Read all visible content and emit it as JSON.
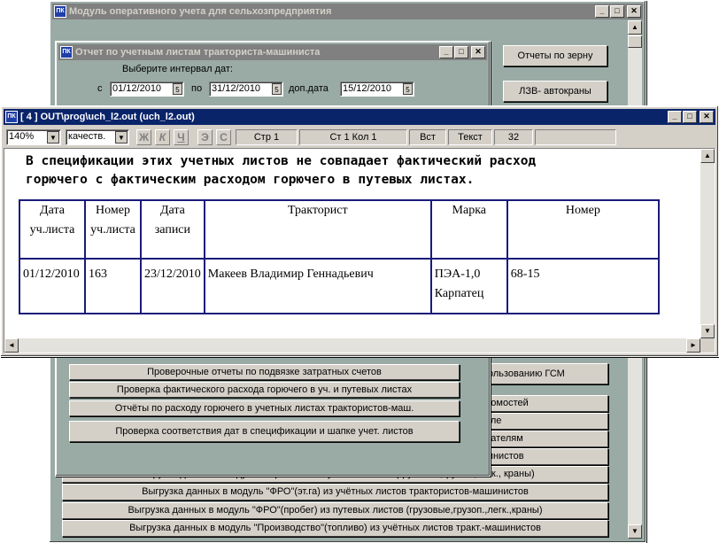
{
  "main_window": {
    "title": "Модуль оперативного учета для сельхозпредприятия",
    "right_buttons": [
      "Отчеты по зерну",
      "ЛЗВ- автокраны",
      "пользованию ГСМ",
      "едомостей",
      "поле",
      "одателям",
      "шинистов"
    ],
    "export_buttons": [
      "Выгрузка данных в модуль \"Зарплата\"из путевых листов (грузовые,грузоп.,легк., краны)",
      "Выгрузка данных в модуль \"ФРО\"(эт.га) из учётных листов трактористов-машинистов",
      "Выгрузка данных в модуль \"ФРО\"(пробег) из путевых листов (грузовые,грузоп.,легк.,краны)",
      "Выгрузка данных в модуль \"Производство\"(топливо) из учётных листов тракт.-машинистов"
    ]
  },
  "report_dialog": {
    "title": "Отчет по учетным листам тракториста-машиниста",
    "interval_label": "Выберите интервал дат:",
    "from_label": "с",
    "to_label": "по",
    "extra_label": "доп.дата",
    "date_from": "01/12/2010",
    "date_to": "31/12/2010",
    "date_extra": "15/12/2010",
    "buttons": [
      "Проверочные отчеты по подвязке затратных счетов",
      "Проверка фактического расхода горючего в уч. и путевых листах",
      "Отчёты по расходу горючего в учетных листах трактористов-маш.",
      "Проверка соответствия дат в спецификации и шапке учет. листов"
    ]
  },
  "viewer": {
    "title": "[ 4 ]  OUT\\prog\\uch_l2.out (uch_l2.out)",
    "zoom": "140%",
    "quality": "качеств.",
    "format_buttons": [
      "Ж",
      "К",
      "Ч",
      "Э",
      "С"
    ],
    "status": {
      "page": "Стр 1",
      "line_col": "Ст 1  Кол 1",
      "mode": "Вст",
      "type": "Текст",
      "num": "32"
    },
    "message_line1": "В спецификации этих учетных листов не совпадает фактический расход",
    "message_line2": "горючего с фактическим расходом горючего в путевых листах.",
    "table": {
      "headers": [
        [
          "Дата",
          "уч.листа"
        ],
        [
          "Номер",
          "уч.листа"
        ],
        [
          "Дата",
          "записи"
        ],
        [
          "Тракторист",
          ""
        ],
        [
          "Марка",
          ""
        ],
        [
          "Номер",
          ""
        ]
      ],
      "rows": [
        [
          "01/12/2010",
          "163",
          "23/12/2010",
          "Макеев Владимир Геннадьевич",
          "ПЭА-1,0 Карпатец",
          "68-15"
        ]
      ]
    }
  },
  "icons": {
    "app": "app-icon",
    "scroll_up": "arrow-up-icon",
    "scroll_down": "arrow-down-icon",
    "scroll_left": "arrow-left-icon",
    "scroll_right": "arrow-right-icon"
  }
}
